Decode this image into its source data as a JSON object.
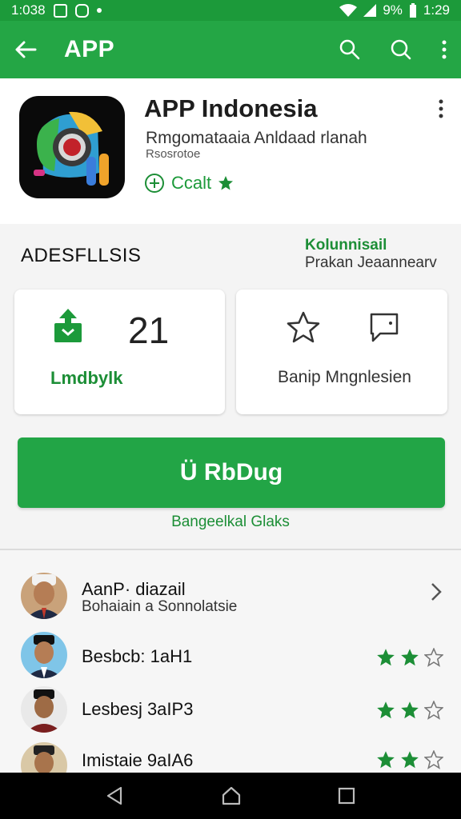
{
  "status_bar": {
    "time_left": "1:038",
    "battery_pct": "9%",
    "time_right": "1:29"
  },
  "app_bar": {
    "title": "APP"
  },
  "app": {
    "name": "APP Indonesia",
    "developer": "Rmgomataaia Anldaad rlanah",
    "subtitle": "Rsosrotoe",
    "rating_label": "Ccalt"
  },
  "section": {
    "title": "ADESFLLSIS",
    "right_title": "Kolunnisail",
    "right_subtitle": "Prakan Jeaannearv",
    "downloads": {
      "count": "21",
      "label": "Lmdbylk"
    },
    "wishlist": {
      "label": "Banip Mngnlesien"
    },
    "install_label": "Ü RbDug",
    "install_note": "Bangeelkal Glaks"
  },
  "reviews": [
    {
      "name": "AanP· diazail",
      "sub": "Bohaiain a Sonnolatsie",
      "stars": 0,
      "chevron": true
    },
    {
      "name": "Besbcb: 1aH1",
      "sub": "",
      "stars": 2,
      "chevron": false
    },
    {
      "name": "Lesbesj 3aIP3",
      "sub": "",
      "stars": 2,
      "chevron": false
    },
    {
      "name": "Imistaie 9aIA6",
      "sub": "",
      "stars": 2,
      "chevron": false
    }
  ],
  "colors": {
    "primary": "#24a645",
    "primary_dark": "#1c9a3a",
    "text_green": "#1c8e36",
    "star": "#1c8e36"
  }
}
